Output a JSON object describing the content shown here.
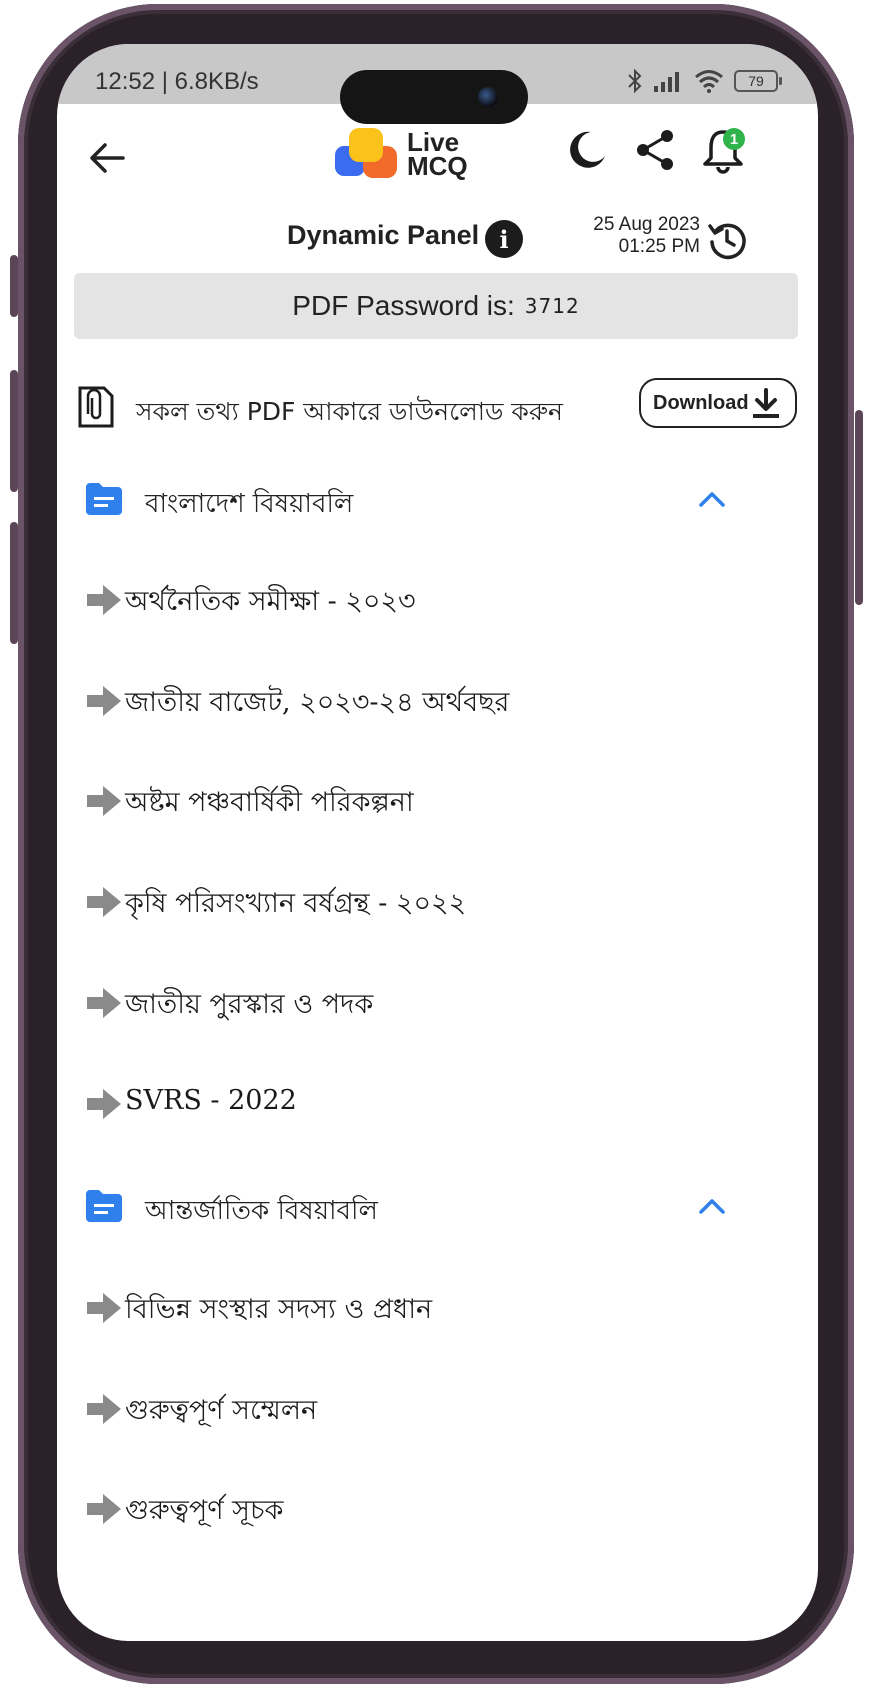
{
  "status_bar": {
    "time": "12:52 | 6.8KB/s",
    "battery": "79"
  },
  "header": {
    "logo_line1": "Live",
    "logo_line2": "MCQ",
    "notification_count": "1"
  },
  "panel": {
    "title": "Dynamic Panel",
    "date": "25 Aug 2023",
    "time": "01:25 PM"
  },
  "password": {
    "label": "PDF Password is:",
    "value": "3712"
  },
  "download": {
    "text": "সকল তথ্য PDF আকারে ডাউনলোড করুন",
    "button_label": "Download"
  },
  "sections": [
    {
      "title": "বাংলাদেশ বিষয়াবলি",
      "items": [
        "অর্থনৈতিক সমীক্ষা - ২০২৩",
        "জাতীয় বাজেট, ২০২৩-২৪ অর্থবছর",
        "অষ্টম পঞ্চবার্ষিকী পরিকল্পনা",
        "কৃষি পরিসংখ্যান বর্ষগ্রন্থ - ২০২২",
        "জাতীয় পুরস্কার ও পদক",
        "SVRS - 2022"
      ]
    },
    {
      "title": "আন্তর্জাতিক বিষয়াবলি",
      "items": [
        "বিভিন্ন সংস্থার সদস্য ও প্রধান",
        "গুরুত্বপূর্ণ সম্মেলন",
        "গুরুত্বপূর্ণ সূচক"
      ]
    }
  ],
  "colors": {
    "accent": "#2f80ed",
    "folder": "#2f80ed",
    "badge": "#2fb34a",
    "password_bg": "#e4e4e4"
  }
}
